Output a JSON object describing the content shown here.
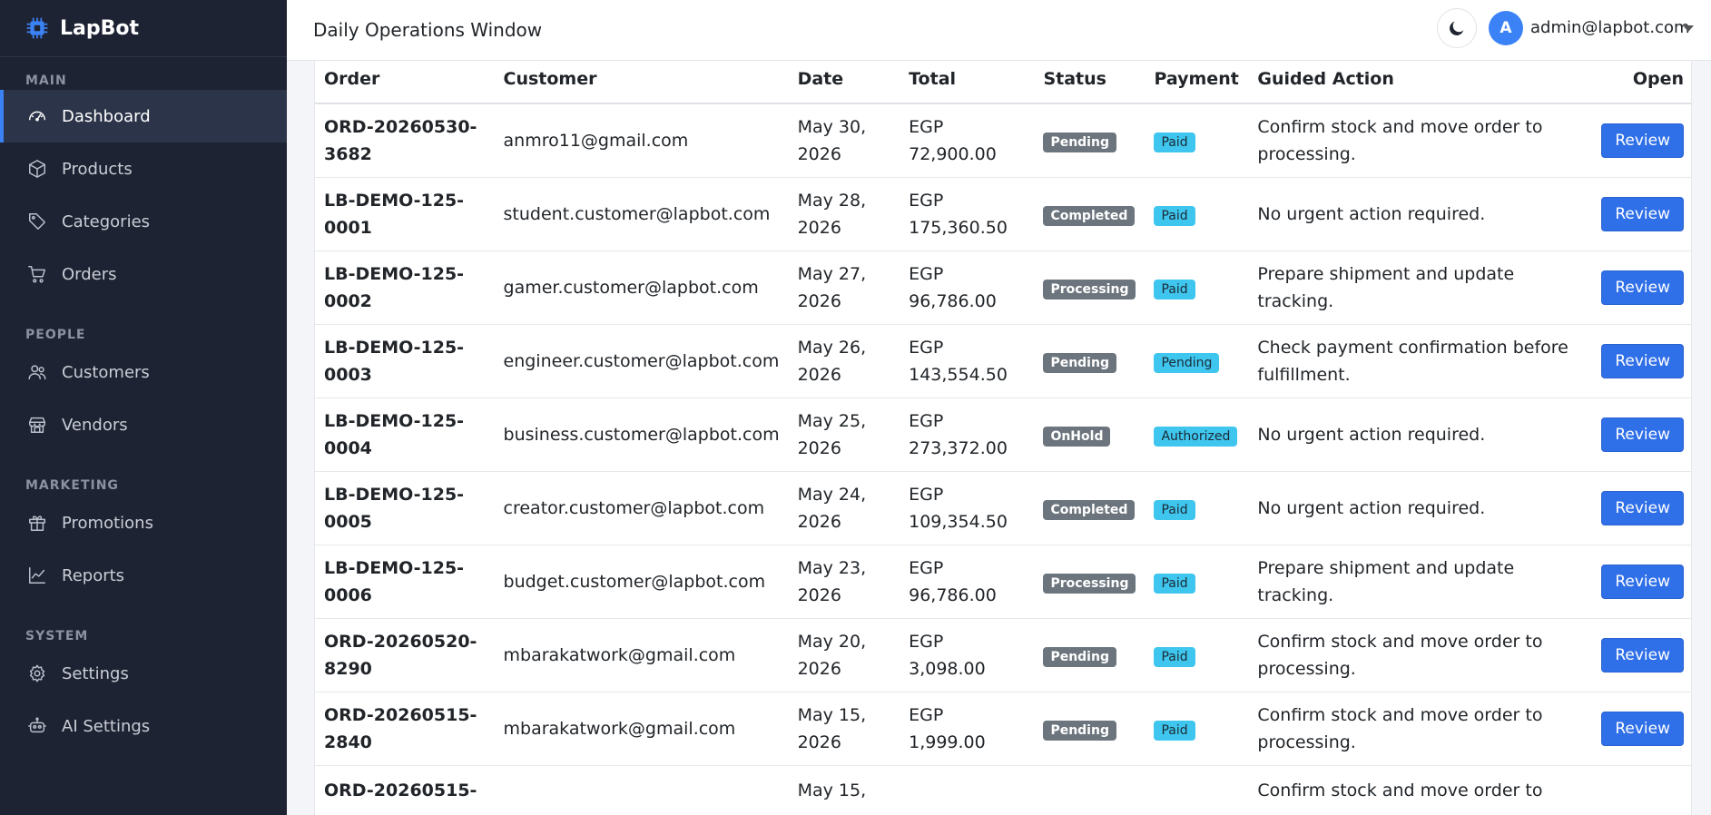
{
  "brand": {
    "name": "LapBot"
  },
  "sidebar": {
    "sections": [
      {
        "label": "MAIN",
        "items": [
          {
            "label": "Dashboard",
            "icon": "gauge-icon",
            "active": true
          },
          {
            "label": "Products",
            "icon": "box-icon"
          },
          {
            "label": "Categories",
            "icon": "tags-icon"
          },
          {
            "label": "Orders",
            "icon": "cart-icon"
          }
        ]
      },
      {
        "label": "PEOPLE",
        "items": [
          {
            "label": "Customers",
            "icon": "people-icon"
          },
          {
            "label": "Vendors",
            "icon": "shop-icon"
          }
        ]
      },
      {
        "label": "MARKETING",
        "items": [
          {
            "label": "Promotions",
            "icon": "gift-icon"
          },
          {
            "label": "Reports",
            "icon": "graph-icon"
          }
        ]
      },
      {
        "label": "SYSTEM",
        "items": [
          {
            "label": "Settings",
            "icon": "gear-icon"
          },
          {
            "label": "AI Settings",
            "icon": "robot-icon"
          }
        ]
      }
    ]
  },
  "header": {
    "title": "Daily Operations Window",
    "avatar_initial": "A",
    "user_email": "admin@lapbot.com"
  },
  "table": {
    "columns": [
      "Order",
      "Customer",
      "Date",
      "Total",
      "Status",
      "Payment",
      "Guided Action",
      "Open"
    ],
    "rows": [
      {
        "order": "ORD-20260530-3682",
        "customer": "anmro11@gmail.com",
        "date": "May 30, 2026",
        "total": "EGP 72,900.00",
        "status": "Pending",
        "payment": "Paid",
        "action": "Confirm stock and move order to processing.",
        "open": "Review"
      },
      {
        "order": "LB-DEMO-125-0001",
        "customer": "student.customer@lapbot.com",
        "date": "May 28, 2026",
        "total": "EGP 175,360.50",
        "status": "Completed",
        "payment": "Paid",
        "action": "No urgent action required.",
        "open": "Review"
      },
      {
        "order": "LB-DEMO-125-0002",
        "customer": "gamer.customer@lapbot.com",
        "date": "May 27, 2026",
        "total": "EGP 96,786.00",
        "status": "Processing",
        "payment": "Paid",
        "action": "Prepare shipment and update tracking.",
        "open": "Review"
      },
      {
        "order": "LB-DEMO-125-0003",
        "customer": "engineer.customer@lapbot.com",
        "date": "May 26, 2026",
        "total": "EGP 143,554.50",
        "status": "Pending",
        "payment": "Pending",
        "action": "Check payment confirmation before fulfillment.",
        "open": "Review"
      },
      {
        "order": "LB-DEMO-125-0004",
        "customer": "business.customer@lapbot.com",
        "date": "May 25, 2026",
        "total": "EGP 273,372.00",
        "status": "OnHold",
        "payment": "Authorized",
        "action": "No urgent action required.",
        "open": "Review"
      },
      {
        "order": "LB-DEMO-125-0005",
        "customer": "creator.customer@lapbot.com",
        "date": "May 24, 2026",
        "total": "EGP 109,354.50",
        "status": "Completed",
        "payment": "Paid",
        "action": "No urgent action required.",
        "open": "Review"
      },
      {
        "order": "LB-DEMO-125-0006",
        "customer": "budget.customer@lapbot.com",
        "date": "May 23, 2026",
        "total": "EGP 96,786.00",
        "status": "Processing",
        "payment": "Paid",
        "action": "Prepare shipment and update tracking.",
        "open": "Review"
      },
      {
        "order": "ORD-20260520-8290",
        "customer": "mbarakatwork@gmail.com",
        "date": "May 20, 2026",
        "total": "EGP 3,098.00",
        "status": "Pending",
        "payment": "Paid",
        "action": "Confirm stock and move order to processing.",
        "open": "Review"
      },
      {
        "order": "ORD-20260515-2840",
        "customer": "mbarakatwork@gmail.com",
        "date": "May 15, 2026",
        "total": "EGP 1,999.00",
        "status": "Pending",
        "payment": "Paid",
        "action": "Confirm stock and move order to processing.",
        "open": "Review"
      },
      {
        "order": "ORD-20260515-",
        "customer": "",
        "date": "May 15,",
        "total": "",
        "status": "",
        "payment": "",
        "action": "Confirm stock and move order to",
        "open": ""
      }
    ]
  },
  "colors": {
    "sidebar_bg": "#1e2333",
    "accent": "#3b82f6",
    "status_badge": "#6c757d",
    "payment_badge": "#3fc6ee",
    "review_button": "#2f6fe8"
  }
}
